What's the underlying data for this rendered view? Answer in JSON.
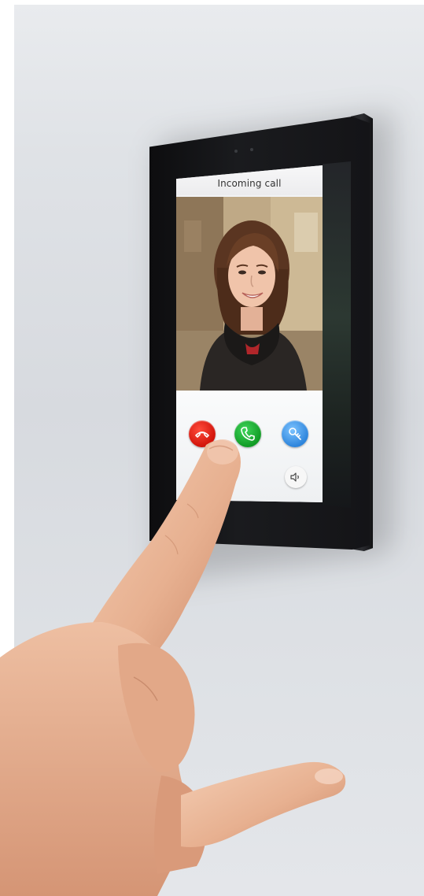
{
  "screen": {
    "title": "Incoming call"
  },
  "buttons": {
    "decline": {
      "icon": "hang-up-icon",
      "color": "#e1201a"
    },
    "accept": {
      "icon": "phone-icon",
      "color": "#1fb033"
    },
    "door": {
      "icon": "key-icon",
      "color": "#4aa0ee"
    },
    "volume": {
      "icon": "speaker-icon",
      "color": "#f7f7f7"
    }
  },
  "colors": {
    "device": "#141417",
    "wall": "#dfe2e6"
  }
}
